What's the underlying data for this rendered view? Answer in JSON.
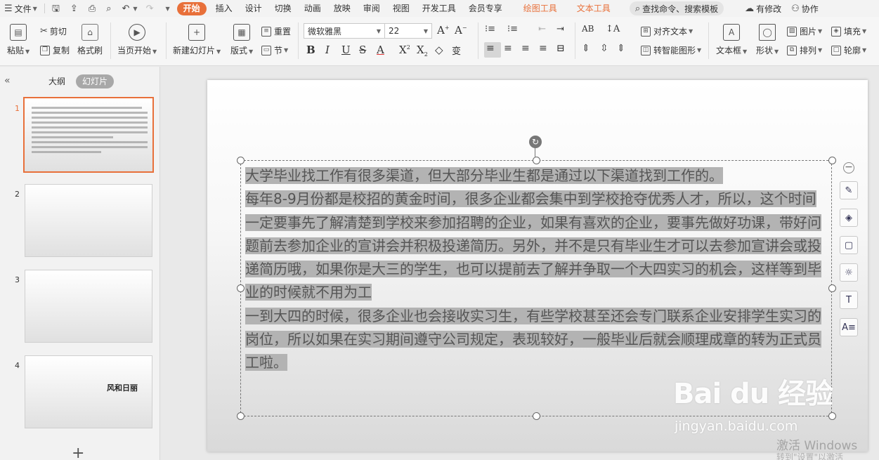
{
  "topbar": {
    "file_menu": "文件",
    "tabs": [
      "开始",
      "插入",
      "设计",
      "切换",
      "动画",
      "放映",
      "审阅",
      "视图",
      "开发工具",
      "会员专享"
    ],
    "context_tabs": [
      "绘图工具",
      "文本工具"
    ],
    "search": "查找命令、搜索模板",
    "revise": "有修改",
    "collab": "协作"
  },
  "ribbon": {
    "paste": "粘贴",
    "cut": "剪切",
    "copy": "复制",
    "format_painter": "格式刷",
    "play_from_current": "当页开始",
    "new_slide": "新建幻灯片",
    "layout": "版式",
    "reset": "重置",
    "section": "节",
    "font_name": "微软雅黑",
    "font_size": "22",
    "align_text": "对齐文本",
    "smart_art": "转智能图形",
    "text_box": "文本框",
    "shape": "形状",
    "picture": "图片",
    "arrange": "排列",
    "fill": "填充",
    "outline": "轮廓"
  },
  "panel": {
    "outline_tab": "大纲",
    "slides_tab": "幻灯片",
    "thumbs": [
      {
        "num": "1",
        "title": ""
      },
      {
        "num": "2",
        "title": ""
      },
      {
        "num": "3",
        "title": ""
      },
      {
        "num": "4",
        "title": "风和日丽"
      }
    ]
  },
  "slide": {
    "paragraphs": [
      "大学毕业找工作有很多渠道，但大部分毕业生都是通过以下渠道找到工作的。",
      "每年8-9月份都是校招的黄金时间，很多企业都会集中到学校抢夺优秀人才，所以，这个时间一定要事先了解清楚到学校来参加招聘的企业，如果有喜欢的企业，要事先做好功课，带好问题前去参加企业的宣讲会并积极投递简历。另外，并不是只有毕业生才可以去参加宣讲会或投递简历哦，如果你是大三的学生，也可以提前去了解并争取一个大四实习的机会，这样等到毕业的时候就不用为工",
      "一到大四的时候，很多企业也会接收实习生，有些学校甚至还会专门联系企业安排学生实习的岗位，所以如果在实习期间遵守公司规定，表现较好，一般毕业后就会顺理成章的转为正式员工啦。"
    ]
  },
  "watermark": {
    "logo": "Bai du 经验",
    "url": "jingyan.baidu.com",
    "activate": "激活 Windows",
    "activate_sub": "转到\"设置\"以激活 Windows。"
  }
}
